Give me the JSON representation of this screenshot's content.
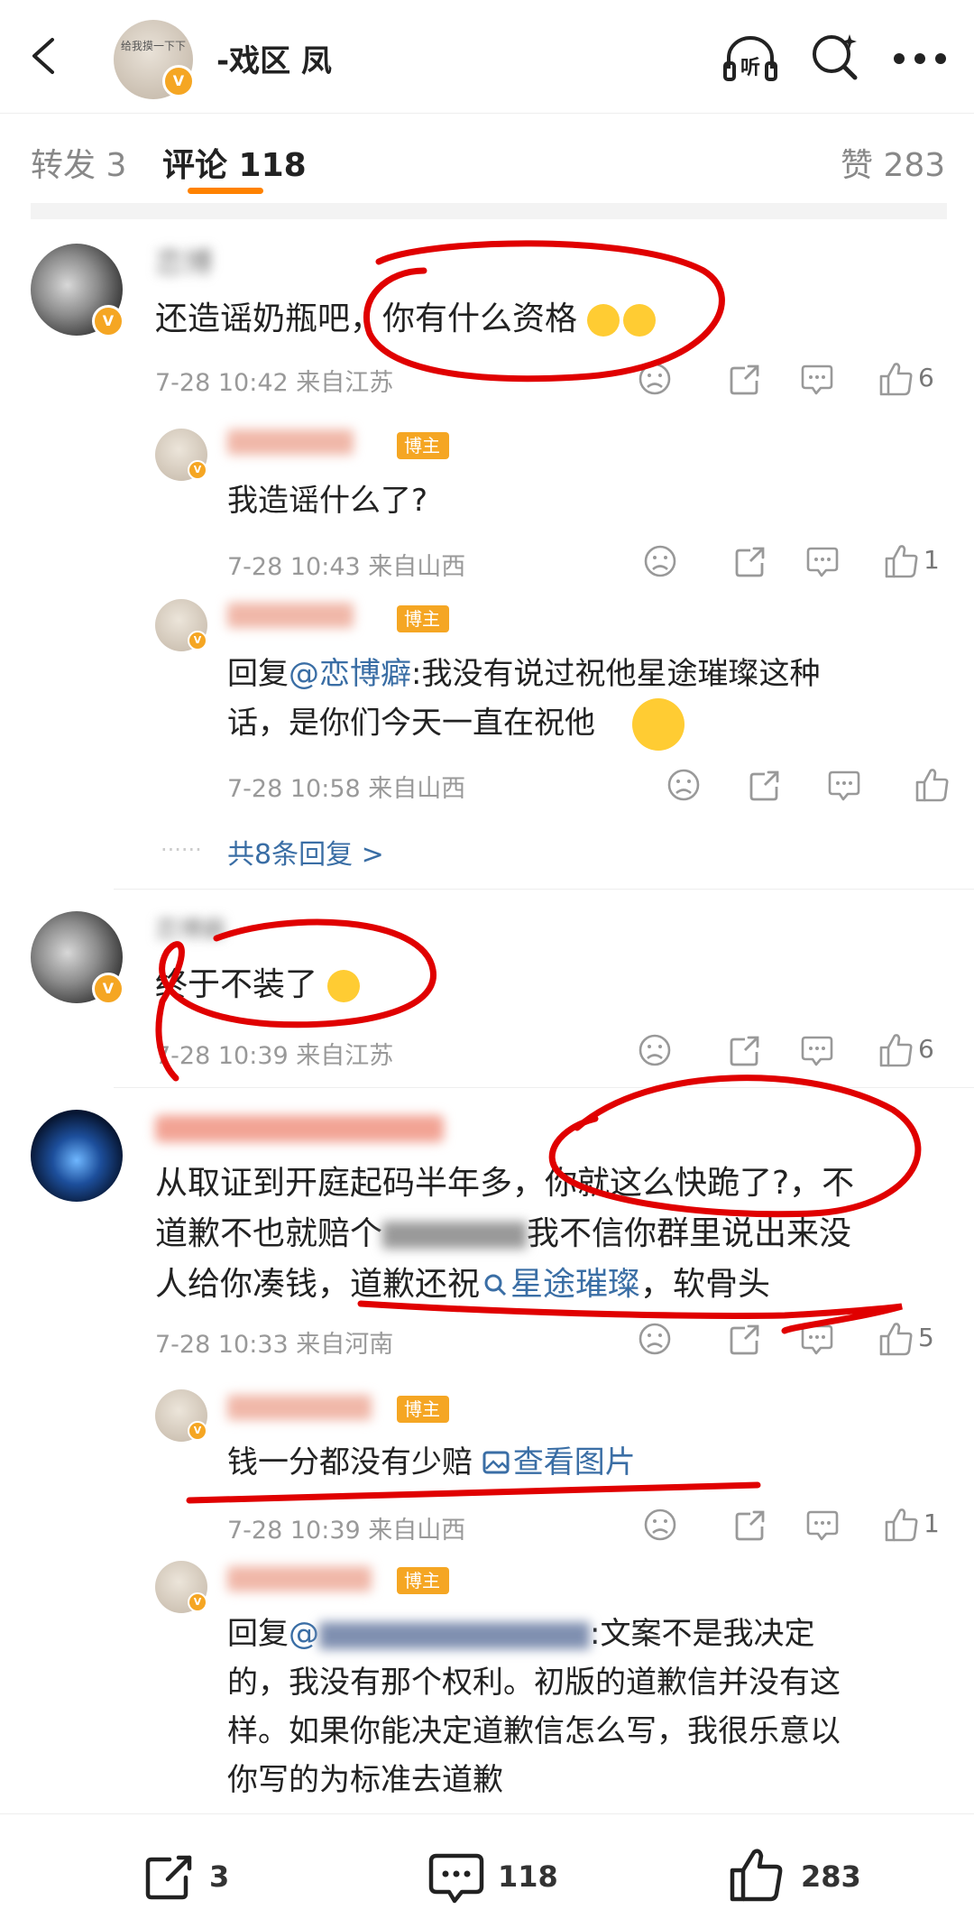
{
  "header": {
    "nav_avatar_text": "给我摸一下下",
    "name": "-戏区 凤"
  },
  "tabs": {
    "repost": "转发 3",
    "comment": "评论 118",
    "likes": "赞 283"
  },
  "comments": [
    {
      "name": "恋博",
      "text": "还造谣奶瓶吧，你有什么资格",
      "time": "7-28 10:42 来自江苏",
      "likes": "6",
      "replies": [
        {
          "badge": "博主",
          "text": "我造谣什么了?",
          "time": "7-28 10:43 来自山西",
          "likes": "1"
        },
        {
          "badge": "博主",
          "prefix": "回复",
          "mention": "@恋博癖",
          "text_line1": ":我没有说过祝他星途璀璨这种",
          "text_line2": "话，是你们今天一直在祝他",
          "time": "7-28 10:58 来自山西"
        }
      ],
      "more_replies": "共8条回复 >"
    },
    {
      "name": "恋博癖",
      "text": "终于不装了",
      "time": "7-28 10:39 来自江苏",
      "likes": "6"
    },
    {
      "name": "",
      "text_line1": "从取证到开庭起码半年多，你就这么快跪了?，不",
      "text_line2": "道歉不也就赔个",
      "text_line2_tail": "我不信你群里说出来没",
      "text_line3_a": "人给你凑钱，道歉还祝",
      "text_line3_link": "星途璀璨",
      "text_line3_b": "，软骨头",
      "time": "7-28 10:33 来自河南",
      "likes": "5",
      "replies": [
        {
          "badge": "博主",
          "text": "钱一分都没有少赔",
          "link": "查看图片",
          "time": "7-28 10:39 来自山西",
          "likes": "1"
        },
        {
          "badge": "博主",
          "prefix": "回复",
          "mention": "@",
          "text_line1": ":文案不是我决定",
          "text_line2": "的，我没有那个权利。初版的道歉信并没有这",
          "text_line3": "样。如果你能决定道歉信怎么写，我很乐意以",
          "text_line4": "你写的为标准去道歉"
        }
      ]
    }
  ],
  "bottom": {
    "repost": "3",
    "comment": "118",
    "like": "283"
  },
  "colors": {
    "accent": "#ff8200",
    "badge": "#f5a623",
    "link": "#3a6ea5",
    "annotation": "#e00000"
  }
}
